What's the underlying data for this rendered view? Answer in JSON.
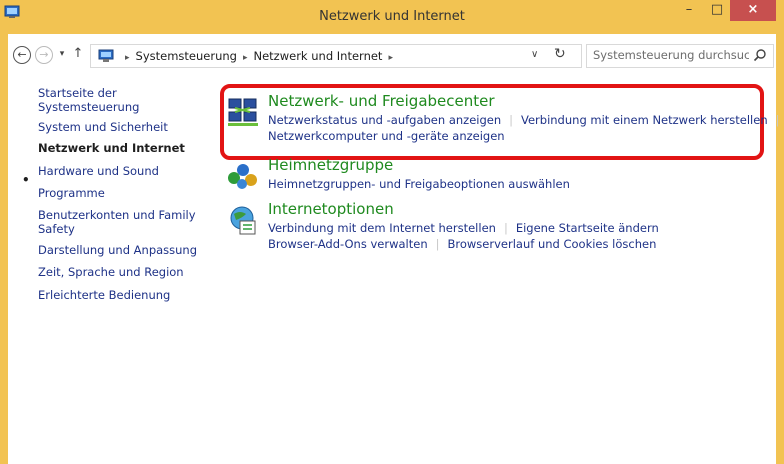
{
  "window": {
    "title": "Netzwerk und Internet",
    "controls": {
      "minimize": "–",
      "maximize": "□",
      "close": "×"
    }
  },
  "toolbar": {
    "back": "←",
    "forward": "→",
    "recent": "▾",
    "up": "↑"
  },
  "address": {
    "crumbs": [
      "Systemsteuerung",
      "Netzwerk und Internet"
    ],
    "separator": "▸",
    "dropdown": "∨",
    "refresh": "↻"
  },
  "search": {
    "placeholder": "Systemsteuerung durchsuchen"
  },
  "sidebar": {
    "bullet": "•",
    "items": [
      {
        "label": "Startseite der Systemsteuerung"
      },
      {
        "label": "System und Sicherheit"
      },
      {
        "label": "Netzwerk und Internet",
        "current": true
      },
      {
        "label": "Hardware und Sound"
      },
      {
        "label": "Programme"
      },
      {
        "label": "Benutzerkonten und Family Safety"
      },
      {
        "label": "Darstellung und Anpassung"
      },
      {
        "label": "Zeit, Sprache und Region"
      },
      {
        "label": "Erleichterte Bedienung"
      }
    ]
  },
  "categories": [
    {
      "title": "Netzwerk- und Freigabecenter",
      "icon": "network-sharing-center-icon",
      "links": [
        "Netzwerkstatus und -aufgaben anzeigen",
        "Verbindung mit einem Netzwerk herstellen",
        "Netzwerkcomputer und -geräte anzeigen"
      ]
    },
    {
      "title": "Heimnetzgruppe",
      "icon": "homegroup-icon",
      "links": [
        "Heimnetzgruppen- und Freigabeoptionen auswählen"
      ]
    },
    {
      "title": "Internetoptionen",
      "icon": "internet-options-icon",
      "links": [
        "Verbindung mit dem Internet herstellen",
        "Eigene Startseite ändern",
        "Browser-Add-Ons verwalten",
        "Browserverlauf und Cookies löschen"
      ]
    }
  ],
  "colors": {
    "titlebar": "#f2c352",
    "link": "#1e3287",
    "category_title": "#1f8a1f",
    "highlight": "#e21414",
    "close": "#c7504f"
  }
}
